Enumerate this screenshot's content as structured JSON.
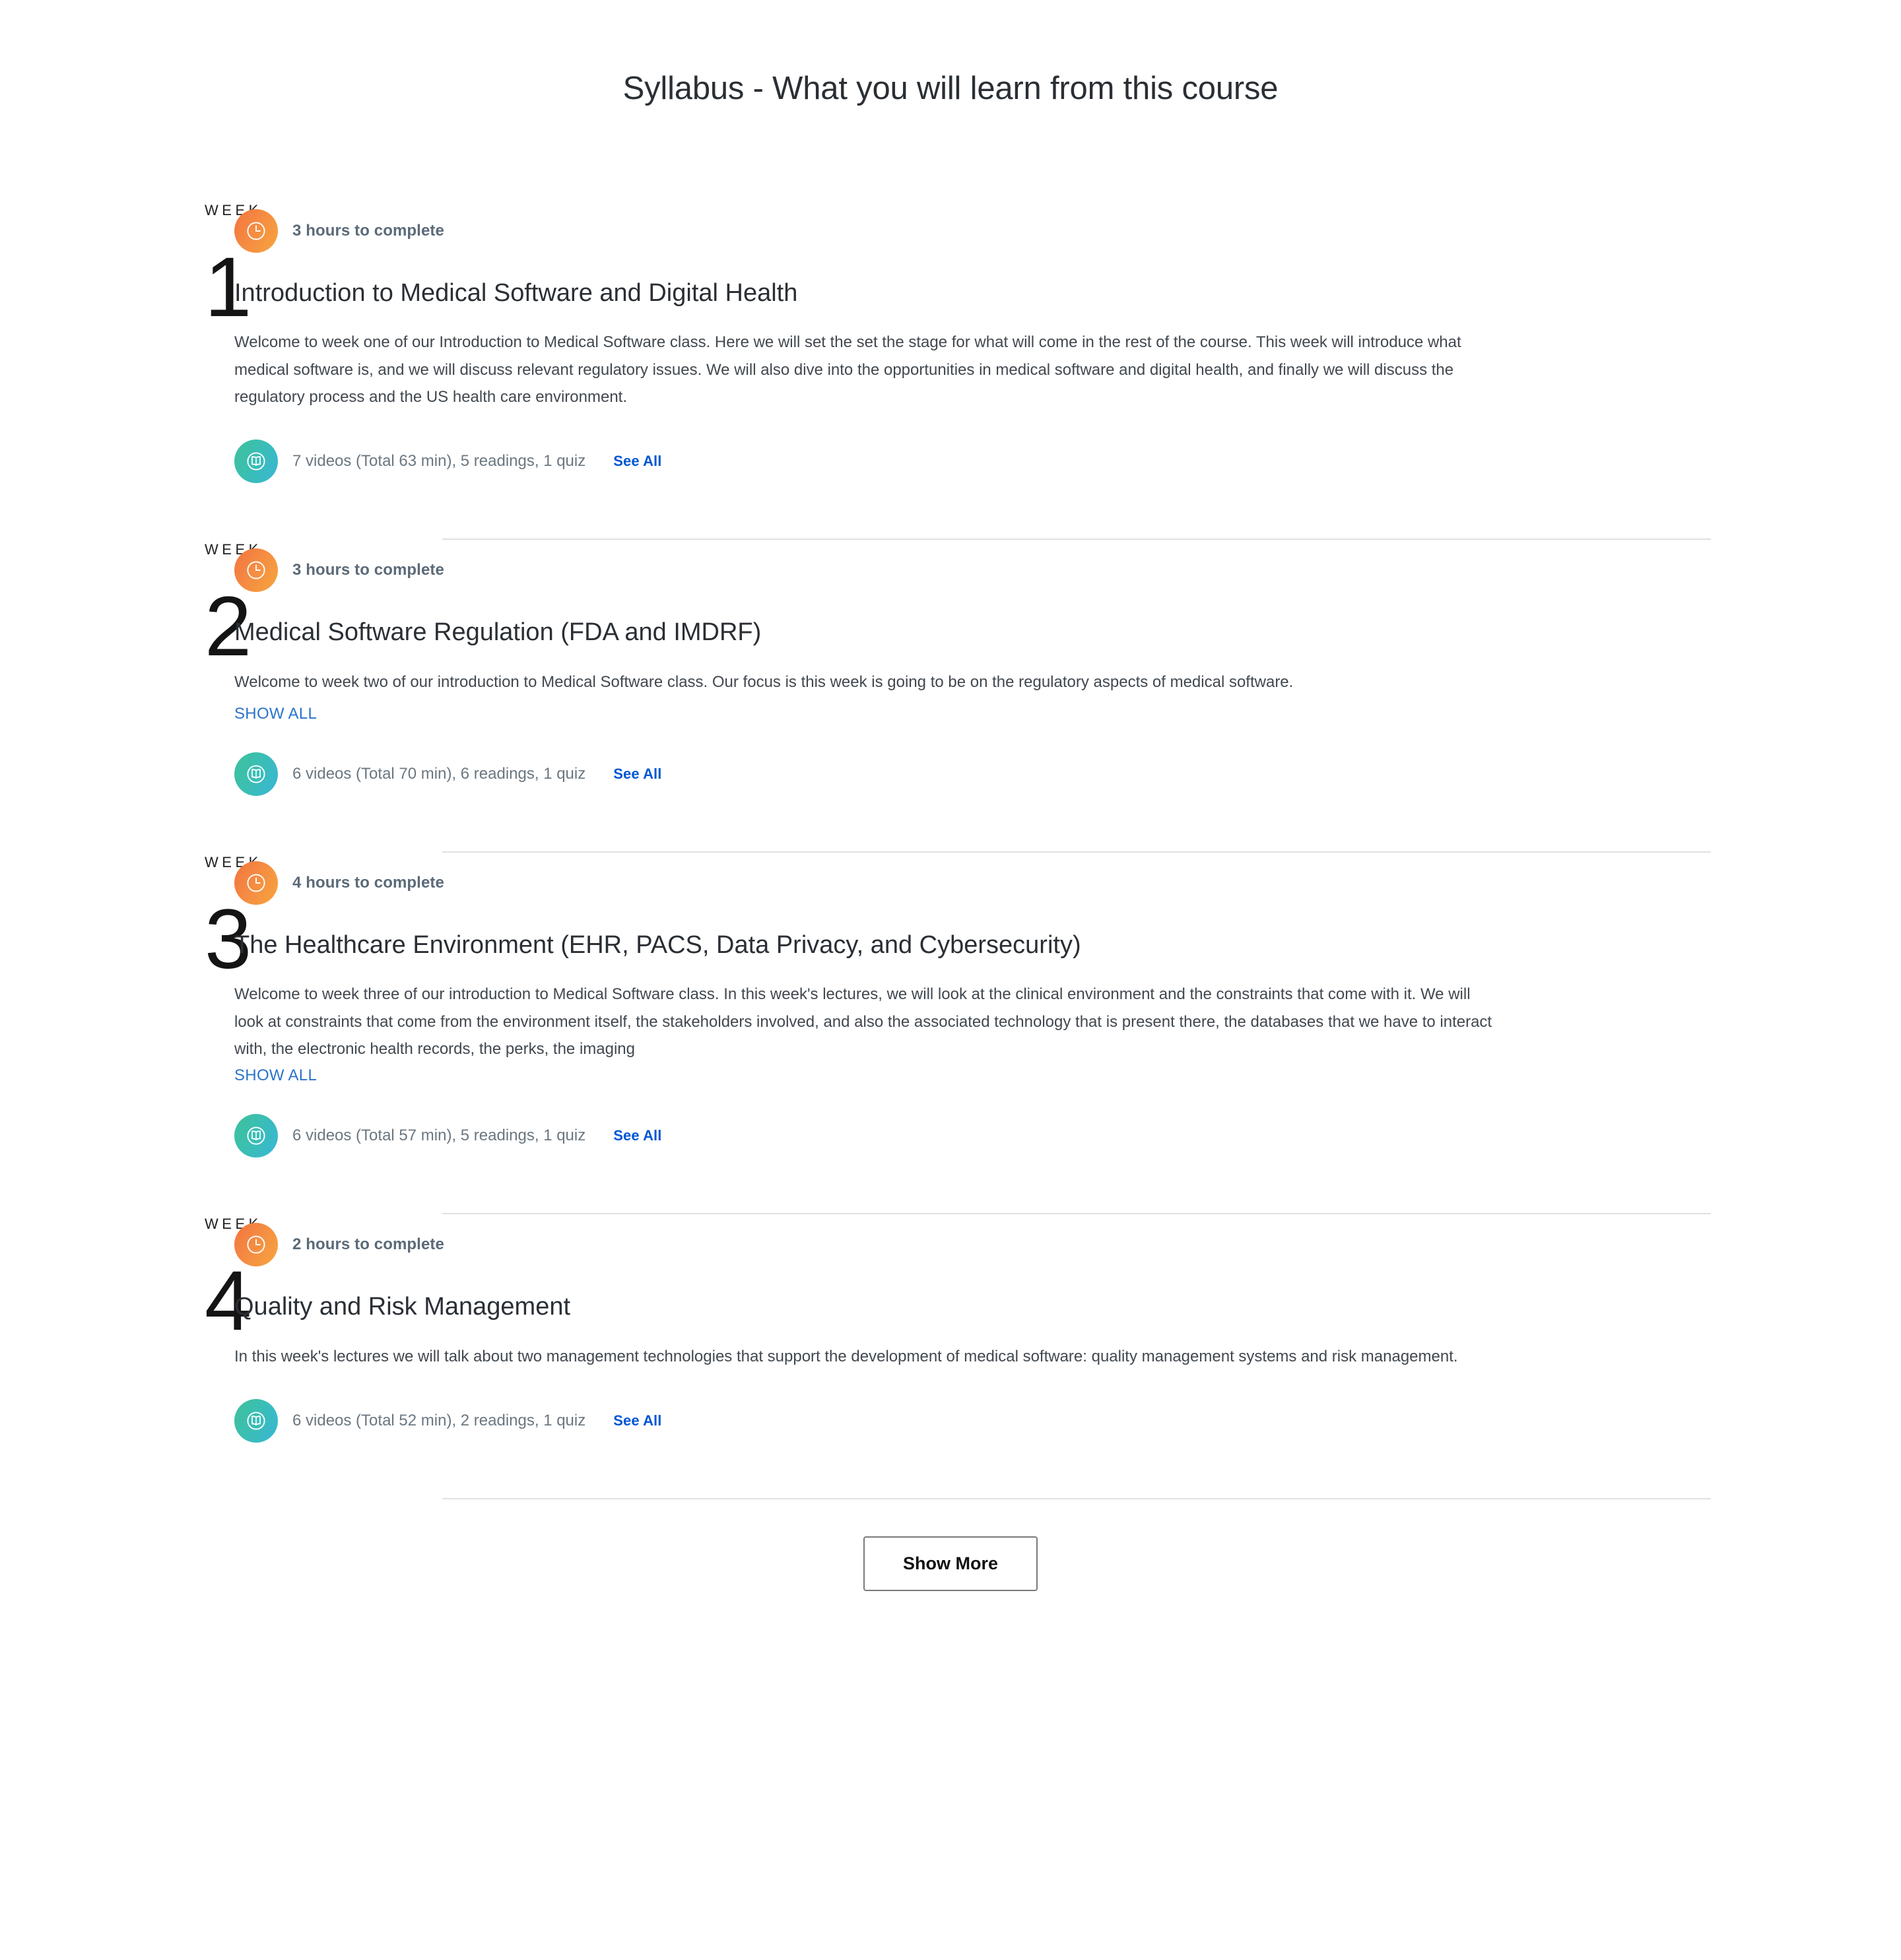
{
  "page": {
    "title": "Syllabus - What you will learn from this course",
    "week_label": "WEEK",
    "show_all_label": "SHOW ALL",
    "see_all_label": "See All",
    "show_more_label": "Show More",
    "colors": {
      "clock_badge_start": "#f2743f",
      "clock_badge_end": "#f6a53f",
      "book_badge_start": "#3fc09a",
      "book_badge_end": "#38b6d6",
      "link_blue": "#0056d2",
      "show_all_blue": "#2a73cc",
      "divider": "#e0e0e0"
    },
    "icons": {
      "clock": "clock-icon",
      "book": "book-icon"
    }
  },
  "weeks": [
    {
      "number": "1",
      "duration": "3 hours to complete",
      "title": "Introduction to Medical Software and Digital Health",
      "description": "Welcome to week one of our Introduction to Medical Software class. Here we will set the set the stage for what will come in the rest of the course. This week will introduce what medical software is, and we will discuss relevant regulatory issues. We will also dive into the opportunities in medical software and digital health, and finally we will discuss the regulatory process and the US health care environment.",
      "has_show_all": false,
      "clamped": false,
      "stats": "7 videos (Total 63 min), 5 readings, 1 quiz"
    },
    {
      "number": "2",
      "duration": "3 hours to complete",
      "title": "Medical Software Regulation (FDA and IMDRF)",
      "description": "Welcome to week two of our introduction to Medical Software class. Our focus is this week is going to be on the regulatory aspects of medical software.",
      "has_show_all": true,
      "clamped": false,
      "stats": "6 videos (Total 70 min), 6 readings, 1 quiz"
    },
    {
      "number": "3",
      "duration": "4 hours to complete",
      "title": "The Healthcare Environment (EHR, PACS, Data Privacy, and Cybersecurity)",
      "description": "Welcome to week three of our introduction to Medical Software class. In this week's lectures, we will look at the clinical environment and the constraints that come with it. We will look at constraints that come from the environment itself, the stakeholders involved, and also the associated technology that is present there, the databases that we have to interact with, the electronic health records, the perks, the imaging",
      "has_show_all": true,
      "clamped": true,
      "stats": "6 videos (Total 57 min), 5 readings, 1 quiz"
    },
    {
      "number": "4",
      "duration": "2 hours to complete",
      "title": "Quality and Risk Management",
      "description": "In this week's lectures we will talk about two management technologies that support the development of medical software: quality management systems and risk management.",
      "has_show_all": false,
      "clamped": false,
      "stats": "6 videos (Total 52 min), 2 readings, 1 quiz"
    }
  ]
}
